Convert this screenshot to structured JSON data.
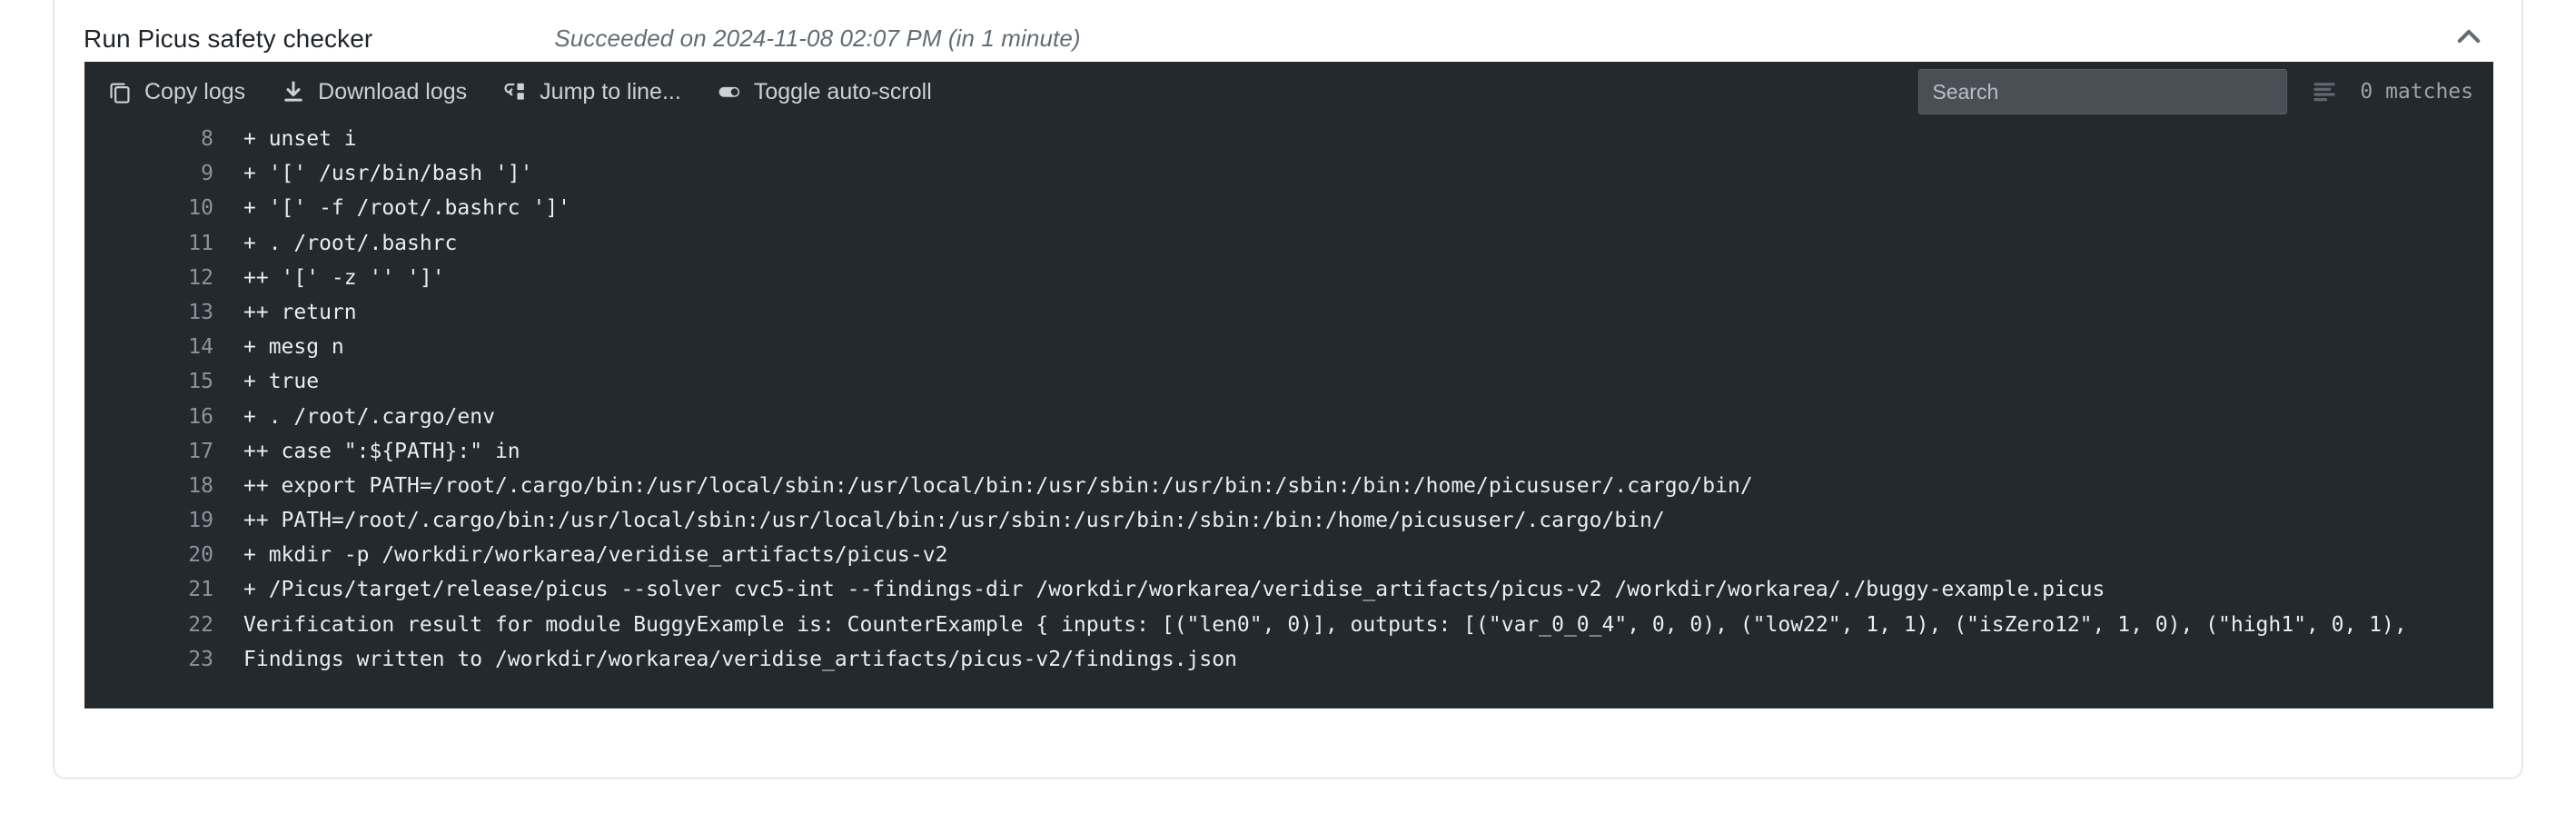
{
  "step": {
    "title": "Run Picus safety checker",
    "status": "Succeeded on 2024-11-08 02:07 PM (in 1 minute)",
    "collapse_icon": "chevron-up-icon"
  },
  "toolbar": {
    "copy_logs": "Copy logs",
    "download_logs": "Download logs",
    "jump_to_line": "Jump to line...",
    "toggle_auto_scroll": "Toggle auto-scroll",
    "copy_icon": "copy-icon",
    "download_icon": "download-icon",
    "jump_icon": "jump-to-line-icon",
    "toggle_icon": "toggle-switch-icon"
  },
  "search": {
    "value": "",
    "placeholder": "Search",
    "matches": "0 matches",
    "filter_icon": "filter-lines-icon"
  },
  "colors": {
    "log_background": "#24292e",
    "log_text": "#e6edf3",
    "line_number": "#8b949e",
    "toolbar_text": "#c9d1d9",
    "card_border": "#d8dee4",
    "title_text": "#1f2328",
    "status_text": "#636c76"
  },
  "log": {
    "lines": [
      {
        "n": "8",
        "t": "+ unset i"
      },
      {
        "n": "9",
        "t": "+ '[' /usr/bin/bash ']'"
      },
      {
        "n": "10",
        "t": "+ '[' -f /root/.bashrc ']'"
      },
      {
        "n": "11",
        "t": "+ . /root/.bashrc"
      },
      {
        "n": "12",
        "t": "++ '[' -z '' ']'"
      },
      {
        "n": "13",
        "t": "++ return"
      },
      {
        "n": "14",
        "t": "+ mesg n"
      },
      {
        "n": "15",
        "t": "+ true"
      },
      {
        "n": "16",
        "t": "+ . /root/.cargo/env"
      },
      {
        "n": "17",
        "t": "++ case \":${PATH}:\" in"
      },
      {
        "n": "18",
        "t": "++ export PATH=/root/.cargo/bin:/usr/local/sbin:/usr/local/bin:/usr/sbin:/usr/bin:/sbin:/bin:/home/picususer/.cargo/bin/"
      },
      {
        "n": "19",
        "t": "++ PATH=/root/.cargo/bin:/usr/local/sbin:/usr/local/bin:/usr/sbin:/usr/bin:/sbin:/bin:/home/picususer/.cargo/bin/"
      },
      {
        "n": "20",
        "t": "+ mkdir -p /workdir/workarea/veridise_artifacts/picus-v2"
      },
      {
        "n": "21",
        "t": "+ /Picus/target/release/picus --solver cvc5-int --findings-dir /workdir/workarea/veridise_artifacts/picus-v2 /workdir/workarea/./buggy-example.picus"
      },
      {
        "n": "22",
        "t": "Verification result for module BuggyExample is: CounterExample { inputs: [(\"len0\", 0)], outputs: [(\"var_0_0_4\", 0, 0), (\"low22\", 1, 1), (\"isZero12\", 1, 0), (\"high1\", 0, 1), "
      },
      {
        "n": "23",
        "t": "Findings written to /workdir/workarea/veridise_artifacts/picus-v2/findings.json"
      }
    ]
  }
}
